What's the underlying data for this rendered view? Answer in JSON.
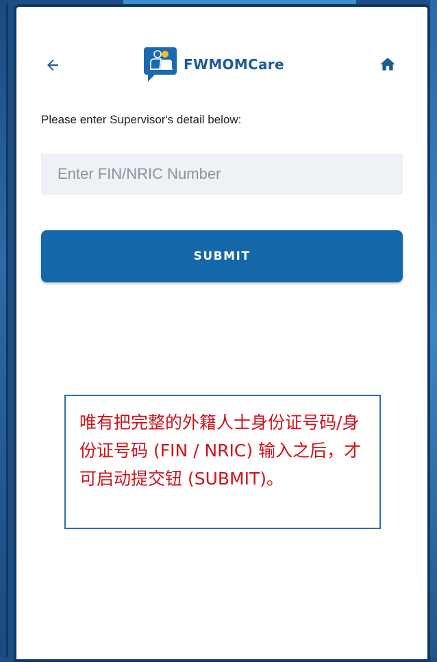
{
  "header": {
    "app_name": "FWMOMCare",
    "back_icon": "arrow-left-icon",
    "home_icon": "home-icon",
    "brand_color": "#1b5b98"
  },
  "form": {
    "instruction": "Please enter Supervisor's detail below:",
    "fin_placeholder": "Enter FIN/NRIC Number",
    "fin_value": "",
    "submit_label": "SUBMIT",
    "submit_color": "#1467a8"
  },
  "annotation": {
    "text": "唯有把完整的外籍人士身份证号码/身份证号码 (FIN / NRIC) 输入之后，才可启动提交钮 (SUBMIT)。",
    "text_color": "#d0121b",
    "border_color": "#2a6db5"
  }
}
